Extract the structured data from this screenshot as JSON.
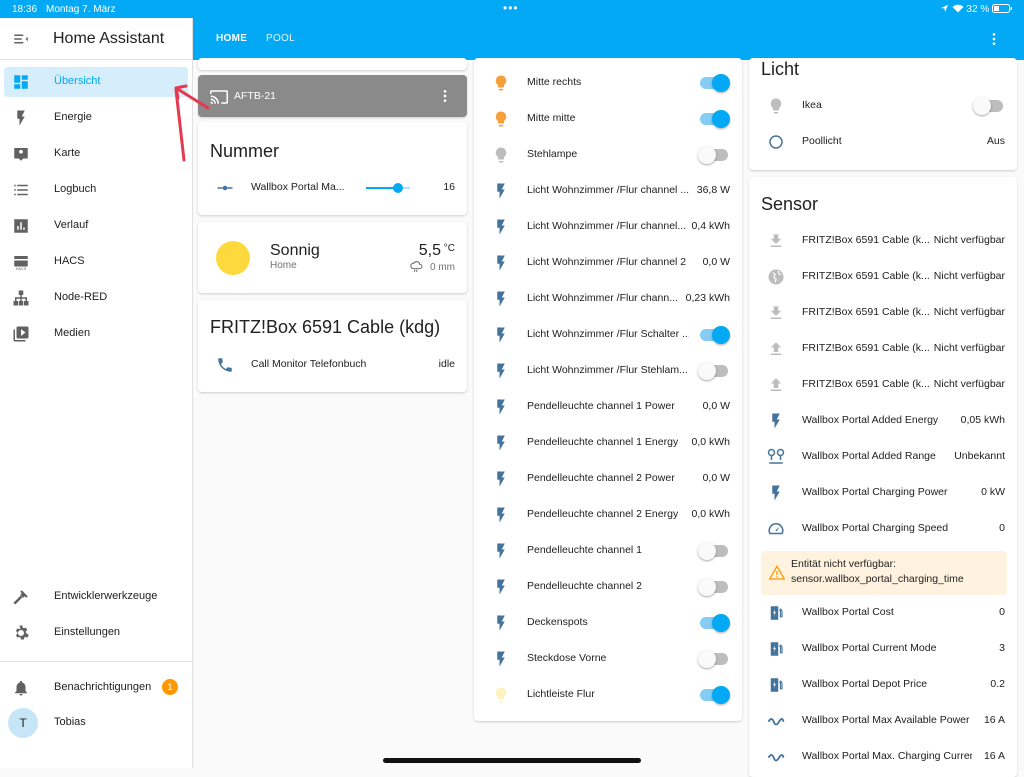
{
  "status": {
    "time": "18:36",
    "date": "Montag 7. März",
    "dots": "•••",
    "battery": "32 %"
  },
  "sidebar": {
    "title": "Home Assistant",
    "items": [
      {
        "label": "Übersicht",
        "icon": "dashboard-icon"
      },
      {
        "label": "Energie",
        "icon": "lightning-icon"
      },
      {
        "label": "Karte",
        "icon": "map-icon"
      },
      {
        "label": "Logbuch",
        "icon": "list-icon"
      },
      {
        "label": "Verlauf",
        "icon": "chart-icon"
      },
      {
        "label": "HACS",
        "icon": "hacs-icon"
      },
      {
        "label": "Node-RED",
        "icon": "sitemap-icon"
      },
      {
        "label": "Medien",
        "icon": "play-icon"
      }
    ],
    "bottom": [
      {
        "label": "Entwicklerwerkzeuge",
        "icon": "hammer-icon"
      },
      {
        "label": "Einstellungen",
        "icon": "gear-icon"
      }
    ],
    "notifications": {
      "label": "Benachrichtigungen",
      "count": "1"
    },
    "user": {
      "name": "Tobias",
      "initial": "T"
    }
  },
  "tabs": [
    "HOME",
    "POOL"
  ],
  "col1": {
    "media": {
      "name": "AFTB-21"
    },
    "number": {
      "title": "Nummer",
      "row": {
        "name": "Wallbox Portal Ma...",
        "value": "16",
        "fraction": 0.72
      }
    },
    "weather": {
      "condition": "Sonnig",
      "location": "Home",
      "temp": "5,5",
      "unit": "°C",
      "precip": "0 mm"
    },
    "fritz": {
      "title": "FRITZ!Box 6591 Cable (kdg)",
      "row": {
        "name": "Call Monitor Telefonbuch",
        "value": "idle"
      }
    }
  },
  "col2": {
    "rows": [
      {
        "name": "Mitte rechts",
        "icon": "bulb-icon",
        "color": "#f5a03a",
        "toggle": true
      },
      {
        "name": "Mitte mitte",
        "icon": "bulb-icon",
        "color": "#f5a03a",
        "toggle": true
      },
      {
        "name": "Stehlampe",
        "icon": "bulb-icon",
        "color": "#bdbdbd",
        "toggle": false
      },
      {
        "name": "Licht Wohnzimmer /Flur channel ...",
        "icon": "lightning-icon",
        "value": "36,8 W"
      },
      {
        "name": "Licht Wohnzimmer /Flur channel...",
        "icon": "lightning-icon",
        "value": "0,4 kWh"
      },
      {
        "name": "Licht Wohnzimmer /Flur channel 2 ...",
        "icon": "lightning-icon",
        "value": "0,0 W"
      },
      {
        "name": "Licht Wohnzimmer /Flur chann...",
        "icon": "lightning-icon",
        "value": "0,23 kWh"
      },
      {
        "name": "Licht Wohnzimmer /Flur Schalter ...",
        "icon": "lightning-icon",
        "toggle": true
      },
      {
        "name": "Licht Wohnzimmer /Flur Stehlam...",
        "icon": "lightning-icon",
        "toggle": false
      },
      {
        "name": "Pendelleuchte channel 1 Power",
        "icon": "lightning-icon",
        "value": "0,0 W"
      },
      {
        "name": "Pendelleuchte channel 1 Energy",
        "icon": "lightning-icon",
        "value": "0,0 kWh"
      },
      {
        "name": "Pendelleuchte channel 2 Power",
        "icon": "lightning-icon",
        "value": "0,0 W"
      },
      {
        "name": "Pendelleuchte channel 2 Energy",
        "icon": "lightning-icon",
        "value": "0,0 kWh"
      },
      {
        "name": "Pendelleuchte channel 1",
        "icon": "lightning-icon",
        "toggle": false
      },
      {
        "name": "Pendelleuchte channel 2",
        "icon": "lightning-icon",
        "toggle": false
      },
      {
        "name": "Deckenspots",
        "icon": "lightning-icon",
        "toggle": true
      },
      {
        "name": "Steckdose Vorne",
        "icon": "lightning-icon",
        "toggle": false
      },
      {
        "name": "Lichtleiste Flur",
        "icon": "bulb-icon",
        "color": "#fdf3c0",
        "toggle": true
      }
    ]
  },
  "col3": {
    "licht": {
      "title": "Licht",
      "rows": [
        {
          "name": "Ikea",
          "icon": "bulb-icon",
          "toggle": false
        },
        {
          "name": "Poollicht",
          "icon": "circle-icon",
          "value": "Aus"
        }
      ]
    },
    "sensor": {
      "title": "Sensor",
      "rows": [
        {
          "name": "FRITZ!Box 6591 Cable (k...",
          "icon": "download-icon",
          "value": "Nicht verfügbar"
        },
        {
          "name": "FRITZ!Box 6591 Cable (k...",
          "icon": "globe-icon",
          "value": "Nicht verfügbar"
        },
        {
          "name": "FRITZ!Box 6591 Cable (k...",
          "icon": "download-icon",
          "value": "Nicht verfügbar"
        },
        {
          "name": "FRITZ!Box 6591 Cable (k...",
          "icon": "upload-icon",
          "value": "Nicht verfügbar"
        },
        {
          "name": "FRITZ!Box 6591 Cable (k...",
          "icon": "upload-icon",
          "value": "Nicht verfügbar"
        },
        {
          "name": "Wallbox Portal Added Energy",
          "icon": "lightning-icon",
          "value": "0,05 kWh"
        },
        {
          "name": "Wallbox Portal Added Range",
          "icon": "map-marker-distance-icon",
          "value": "Unbekannt"
        },
        {
          "name": "Wallbox Portal Charging Power",
          "icon": "lightning-icon",
          "value": "0 kW"
        },
        {
          "name": "Wallbox Portal Charging Speed",
          "icon": "speedometer-icon",
          "value": "0"
        }
      ],
      "warning": {
        "line1": "Entität nicht verfügbar:",
        "line2": "sensor.wallbox_portal_charging_time"
      },
      "rows2": [
        {
          "name": "Wallbox Portal Cost",
          "icon": "ev-station-icon",
          "value": "0"
        },
        {
          "name": "Wallbox Portal Current Mode",
          "icon": "ev-station-icon",
          "value": "3"
        },
        {
          "name": "Wallbox Portal Depot Price",
          "icon": "ev-station-icon",
          "value": "0.2"
        },
        {
          "name": "Wallbox Portal Max Available Power",
          "icon": "current-ac-icon",
          "value": "16 A"
        },
        {
          "name": "Wallbox Portal Max. Charging Current",
          "icon": "current-ac-icon",
          "value": "16 A"
        }
      ]
    }
  }
}
